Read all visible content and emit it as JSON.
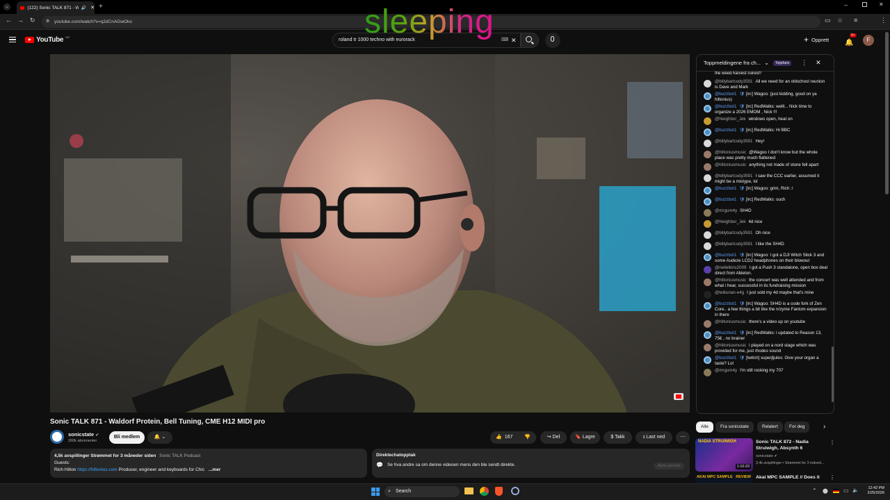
{
  "browser": {
    "tab_title": "(122) Sonic TALK 871 - Wal",
    "url": "youtube.com/watch?v=q2dCnAGwOko",
    "profile_initial": "F"
  },
  "overlay": {
    "text": "sleeping"
  },
  "youtube": {
    "logo": "YouTube",
    "logo_region": "NO",
    "search_value": "roland tr 1000 techno with eurorack",
    "create_label": "Opprett",
    "notif_count": "9+",
    "avatar_initial": "F"
  },
  "video": {
    "title": "Sonic TALK 871 - Waldorf Protein, Bell Tuning, CME H12 MIDI pro",
    "channel": "sonicstate",
    "subscribers": "260k abonnenter",
    "join_label": "Bli medlem",
    "likes": "167",
    "share_label": "Del",
    "save_label": "Lagre",
    "thanks_label": "Takk",
    "download_label": "Last ned"
  },
  "description": {
    "stats": "4,5k avspillinger  Strømmet for 3 måneder siden",
    "podcast": "Sonic TALK Podcast",
    "line2": "Guests:",
    "line3_prefix": "Rich Hilton ",
    "line3_link": "https://hiltonius.com",
    "line3_suffix": " Producer, engineer and keyboards for Chic",
    "more": "...mer"
  },
  "live_replay": {
    "heading": "Direktechatopptak",
    "text": "Se hva andre sa om denne videoen mens den ble sendt direkte.",
    "button": "Åpne panelet"
  },
  "chat": {
    "header": "Toppmeldingene fra ch...",
    "badge": "Toppfans",
    "partial_top": "the weed harvest ruined?",
    "messages": [
      {
        "user": "@billybartcody3591",
        "text": "All we need for an oldschool reunion is Dave and Mark",
        "bot": false,
        "color": "#d9d9d9"
      },
      {
        "user": "@buzzbot1",
        "text": "[irc] Wagoo: (just kidding, good on ya hiltonius)",
        "bot": true,
        "color": "#4a90c2"
      },
      {
        "user": "@buzzbot1",
        "text": "[irc] RedWalks: welll... Nick time to organize a 2026 EMOM , Nick !!!",
        "bot": true,
        "color": "#4a90c2"
      },
      {
        "user": "@Neighbor_Jek",
        "text": "windows open, heat on",
        "bot": false,
        "color": "#c89a32"
      },
      {
        "user": "@buzzbot1",
        "text": "[irc] RedWalks: Hi BBC",
        "bot": true,
        "color": "#4a90c2"
      },
      {
        "user": "@billybartcody3591",
        "text": "Hey!",
        "bot": false,
        "color": "#d9d9d9"
      },
      {
        "user": "@hiltoniusmusic",
        "text": "@Wagoo I don't know but the whole place was pretty much flattened",
        "bot": false,
        "color": "#9a7a6a"
      },
      {
        "user": "@hiltoniusmusic",
        "text": "anything not made of stone fell apart",
        "bot": false,
        "color": "#9a7a6a"
      },
      {
        "user": "@billybartcody3591",
        "text": "I saw the CCC earlier, assumed it might be a mistype, lol",
        "bot": false,
        "color": "#d9d9d9"
      },
      {
        "user": "@buzzbot1",
        "text": "[irc] Wagoo: grim, Rich :/",
        "bot": true,
        "color": "#4a90c2"
      },
      {
        "user": "@buzzbot1",
        "text": "[irc] RedWalks: ouch",
        "bot": true,
        "color": "#4a90c2"
      },
      {
        "user": "@mrgum4y",
        "text": "SH4D",
        "bot": false,
        "color": "#8a7a5a"
      },
      {
        "user": "@Neighbor_Jek",
        "text": "4d nice",
        "bot": false,
        "color": "#c89a32"
      },
      {
        "user": "@billybartcody3591",
        "text": "Oh nice",
        "bot": false,
        "color": "#d9d9d9"
      },
      {
        "user": "@billybartcody3591",
        "text": "I like the SH4D",
        "bot": false,
        "color": "#d9d9d9"
      },
      {
        "user": "@buzzbot1",
        "text": "[irc] Wagoo: I got a DJI Witch Stick 3 and some Audeze LCD2 headphones on their blowout",
        "bot": true,
        "color": "#4a90c2"
      },
      {
        "user": "@neilelkins2009",
        "text": "I got a Push 3 standalone, open box deal direct from Ableton.",
        "bot": false,
        "color": "#5b3fa8"
      },
      {
        "user": "@hiltoniusmusic",
        "text": "the concert was well attended and from what i hear, successful in its fundraising mission",
        "bot": false,
        "color": "#9a7a6a"
      },
      {
        "user": "@telkurian-e4g",
        "text": "I just sold my 4d maybe that's mine",
        "bot": false,
        "color": "#222"
      },
      {
        "user": "@buzzbot1",
        "text": "[irc] Wagoo: SH4D is a code fork of Zen Core.. a few things a bit like the n/zyme Fantom expansion in there",
        "bot": true,
        "color": "#4a90c2"
      },
      {
        "user": "@hiltoniusmusic",
        "text": "there's a video up on youtube",
        "bot": false,
        "color": "#9a7a6a"
      },
      {
        "user": "@buzzbot1",
        "text": "[irc] RedWalks: i updated to Reason 13, 75€ , no brainer",
        "bot": true,
        "color": "#4a90c2"
      },
      {
        "user": "@hiltoniusmusic",
        "text": "i played on a nord stage which was provided for me, just rhodes sound",
        "bot": false,
        "color": "#9a7a6a"
      },
      {
        "user": "@buzzbot1",
        "text": "[twitch] superjljules: Give your organ a taste? Lol",
        "bot": true,
        "color": "#4a90c2"
      },
      {
        "user": "@mrgum4y",
        "text": "I'm still rocking my 707",
        "bot": false,
        "color": "#8a7a5a"
      }
    ]
  },
  "chips": [
    "Alle",
    "Fra sonicstate",
    "Relatert",
    "For deg"
  ],
  "recommendations": [
    {
      "title": "Sonic TALK 872 - Nadia Struiwigh, Absynth 6",
      "channel": "sonicstate",
      "meta": "3,4k avspillinger • Strømmet for 3 måned...",
      "duration": "1:10:23",
      "thumb_text": "NADIA STRUIWIGH"
    },
    {
      "title": "Akai MPC SAMPLE // Does it",
      "channel": "",
      "meta": "",
      "duration": "",
      "thumb_text": "AKAI MPC SAMPLE   REVIEW"
    }
  ],
  "taskbar": {
    "search": "Search",
    "time": "12:42 PM",
    "date": "2/25/2026"
  }
}
